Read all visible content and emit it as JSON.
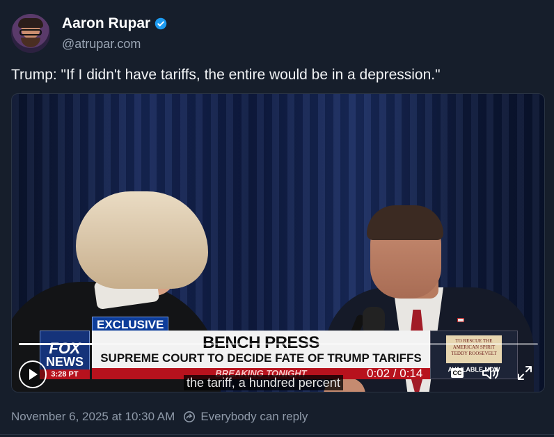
{
  "author": {
    "name": "Aaron Rupar",
    "handle": "@atrupar.com",
    "verified_color": "#1d9bf0"
  },
  "post": {
    "text": "Trump: \"If I didn't have tariffs, the entire would be in a depression.\""
  },
  "video": {
    "overlay": {
      "tag": "EXCLUSIVE",
      "network_line1": "FOX",
      "network_line2": "NEWS",
      "network_time": "3:28 PT",
      "headline": "BENCH PRESS",
      "subheadline": "SUPREME COURT TO DECIDE FATE OF TRUMP TARIFFS",
      "ticker": "BREAKING TONIGHT",
      "book_title": "TO RESCUE THE AMERICAN SPIRIT",
      "book_author": "TEDDY ROOSEVELT",
      "book_avail": "AVAILABLE NOW"
    },
    "caption": "the tariff, a hundred percent",
    "current_time": "0:02",
    "duration": "0:14",
    "time_display": "0:02 / 0:14",
    "progress_fraction": 0.143,
    "cc_label": "CC",
    "icons": [
      "play-icon",
      "cc-icon",
      "volume-icon",
      "fullscreen-icon"
    ]
  },
  "meta": {
    "date": "November 6, 2025 at 10:30 AM",
    "reply_setting": "Everybody can reply"
  }
}
